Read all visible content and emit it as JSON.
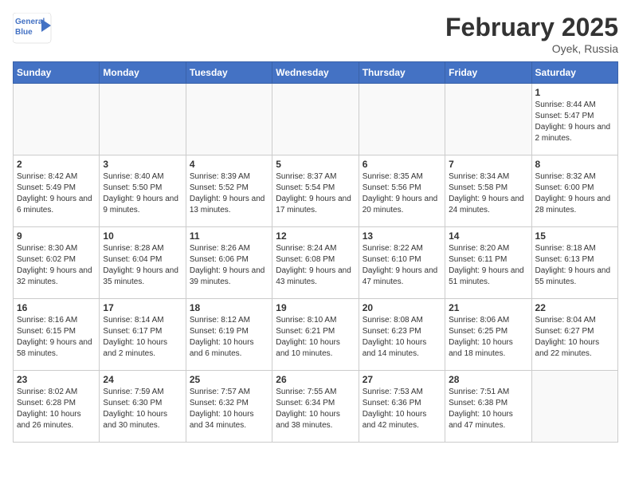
{
  "header": {
    "logo_line1": "General",
    "logo_line2": "Blue",
    "month_year": "February 2025",
    "location": "Oyek, Russia"
  },
  "days_of_week": [
    "Sunday",
    "Monday",
    "Tuesday",
    "Wednesday",
    "Thursday",
    "Friday",
    "Saturday"
  ],
  "weeks": [
    [
      {
        "day": "",
        "info": ""
      },
      {
        "day": "",
        "info": ""
      },
      {
        "day": "",
        "info": ""
      },
      {
        "day": "",
        "info": ""
      },
      {
        "day": "",
        "info": ""
      },
      {
        "day": "",
        "info": ""
      },
      {
        "day": "1",
        "info": "Sunrise: 8:44 AM\nSunset: 5:47 PM\nDaylight: 9 hours and 2 minutes."
      }
    ],
    [
      {
        "day": "2",
        "info": "Sunrise: 8:42 AM\nSunset: 5:49 PM\nDaylight: 9 hours and 6 minutes."
      },
      {
        "day": "3",
        "info": "Sunrise: 8:40 AM\nSunset: 5:50 PM\nDaylight: 9 hours and 9 minutes."
      },
      {
        "day": "4",
        "info": "Sunrise: 8:39 AM\nSunset: 5:52 PM\nDaylight: 9 hours and 13 minutes."
      },
      {
        "day": "5",
        "info": "Sunrise: 8:37 AM\nSunset: 5:54 PM\nDaylight: 9 hours and 17 minutes."
      },
      {
        "day": "6",
        "info": "Sunrise: 8:35 AM\nSunset: 5:56 PM\nDaylight: 9 hours and 20 minutes."
      },
      {
        "day": "7",
        "info": "Sunrise: 8:34 AM\nSunset: 5:58 PM\nDaylight: 9 hours and 24 minutes."
      },
      {
        "day": "8",
        "info": "Sunrise: 8:32 AM\nSunset: 6:00 PM\nDaylight: 9 hours and 28 minutes."
      }
    ],
    [
      {
        "day": "9",
        "info": "Sunrise: 8:30 AM\nSunset: 6:02 PM\nDaylight: 9 hours and 32 minutes."
      },
      {
        "day": "10",
        "info": "Sunrise: 8:28 AM\nSunset: 6:04 PM\nDaylight: 9 hours and 35 minutes."
      },
      {
        "day": "11",
        "info": "Sunrise: 8:26 AM\nSunset: 6:06 PM\nDaylight: 9 hours and 39 minutes."
      },
      {
        "day": "12",
        "info": "Sunrise: 8:24 AM\nSunset: 6:08 PM\nDaylight: 9 hours and 43 minutes."
      },
      {
        "day": "13",
        "info": "Sunrise: 8:22 AM\nSunset: 6:10 PM\nDaylight: 9 hours and 47 minutes."
      },
      {
        "day": "14",
        "info": "Sunrise: 8:20 AM\nSunset: 6:11 PM\nDaylight: 9 hours and 51 minutes."
      },
      {
        "day": "15",
        "info": "Sunrise: 8:18 AM\nSunset: 6:13 PM\nDaylight: 9 hours and 55 minutes."
      }
    ],
    [
      {
        "day": "16",
        "info": "Sunrise: 8:16 AM\nSunset: 6:15 PM\nDaylight: 9 hours and 58 minutes."
      },
      {
        "day": "17",
        "info": "Sunrise: 8:14 AM\nSunset: 6:17 PM\nDaylight: 10 hours and 2 minutes."
      },
      {
        "day": "18",
        "info": "Sunrise: 8:12 AM\nSunset: 6:19 PM\nDaylight: 10 hours and 6 minutes."
      },
      {
        "day": "19",
        "info": "Sunrise: 8:10 AM\nSunset: 6:21 PM\nDaylight: 10 hours and 10 minutes."
      },
      {
        "day": "20",
        "info": "Sunrise: 8:08 AM\nSunset: 6:23 PM\nDaylight: 10 hours and 14 minutes."
      },
      {
        "day": "21",
        "info": "Sunrise: 8:06 AM\nSunset: 6:25 PM\nDaylight: 10 hours and 18 minutes."
      },
      {
        "day": "22",
        "info": "Sunrise: 8:04 AM\nSunset: 6:27 PM\nDaylight: 10 hours and 22 minutes."
      }
    ],
    [
      {
        "day": "23",
        "info": "Sunrise: 8:02 AM\nSunset: 6:28 PM\nDaylight: 10 hours and 26 minutes."
      },
      {
        "day": "24",
        "info": "Sunrise: 7:59 AM\nSunset: 6:30 PM\nDaylight: 10 hours and 30 minutes."
      },
      {
        "day": "25",
        "info": "Sunrise: 7:57 AM\nSunset: 6:32 PM\nDaylight: 10 hours and 34 minutes."
      },
      {
        "day": "26",
        "info": "Sunrise: 7:55 AM\nSunset: 6:34 PM\nDaylight: 10 hours and 38 minutes."
      },
      {
        "day": "27",
        "info": "Sunrise: 7:53 AM\nSunset: 6:36 PM\nDaylight: 10 hours and 42 minutes."
      },
      {
        "day": "28",
        "info": "Sunrise: 7:51 AM\nSunset: 6:38 PM\nDaylight: 10 hours and 47 minutes."
      },
      {
        "day": "",
        "info": ""
      }
    ]
  ]
}
